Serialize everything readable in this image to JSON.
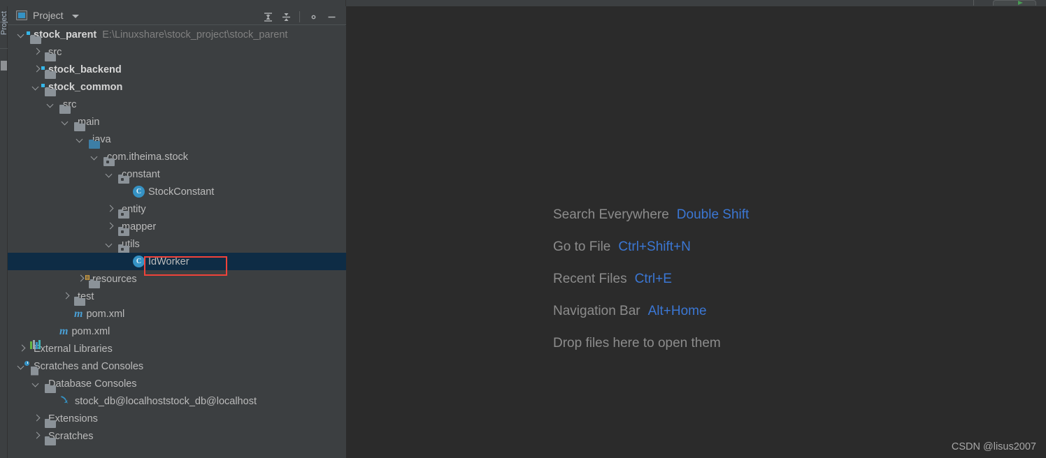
{
  "window": {
    "tool_window_title": "Project",
    "vertical_strip_label": "Project",
    "toolbar_buttons": [
      {
        "name": "expand-all",
        "tooltip": "Expand All"
      },
      {
        "name": "collapse-all",
        "tooltip": "Collapse All"
      },
      {
        "name": "settings",
        "tooltip": "Settings"
      },
      {
        "name": "hide",
        "tooltip": "Hide"
      }
    ]
  },
  "tree": {
    "rows": [
      {
        "indent": 0,
        "arrow": "down",
        "icon": "module-folder",
        "label": "stock_parent",
        "bold": true,
        "sub": "E:\\Linuxshare\\stock_project\\stock_parent",
        "selected": false
      },
      {
        "indent": 1,
        "arrow": "right",
        "icon": "folder",
        "label": "src",
        "bold": false,
        "sub": "",
        "selected": false
      },
      {
        "indent": 1,
        "arrow": "right",
        "icon": "module-folder",
        "label": "stock_backend",
        "bold": true,
        "sub": "",
        "selected": false
      },
      {
        "indent": 1,
        "arrow": "down",
        "icon": "module-folder",
        "label": "stock_common",
        "bold": true,
        "sub": "",
        "selected": false
      },
      {
        "indent": 2,
        "arrow": "down",
        "icon": "folder",
        "label": "src",
        "bold": false,
        "sub": "",
        "selected": false
      },
      {
        "indent": 3,
        "arrow": "down",
        "icon": "folder",
        "label": "main",
        "bold": false,
        "sub": "",
        "selected": false
      },
      {
        "indent": 4,
        "arrow": "down",
        "icon": "source-folder",
        "label": "java",
        "bold": false,
        "sub": "",
        "selected": false
      },
      {
        "indent": 5,
        "arrow": "down",
        "icon": "package",
        "label": "com.itheima.stock",
        "bold": false,
        "sub": "",
        "selected": false
      },
      {
        "indent": 6,
        "arrow": "down",
        "icon": "package",
        "label": "constant",
        "bold": false,
        "sub": "",
        "selected": false
      },
      {
        "indent": 7,
        "arrow": "none",
        "icon": "java-class",
        "label": "StockConstant",
        "bold": false,
        "sub": "",
        "selected": false
      },
      {
        "indent": 6,
        "arrow": "right",
        "icon": "package",
        "label": "entity",
        "bold": false,
        "sub": "",
        "selected": false
      },
      {
        "indent": 6,
        "arrow": "right",
        "icon": "package",
        "label": "mapper",
        "bold": false,
        "sub": "",
        "selected": false
      },
      {
        "indent": 6,
        "arrow": "down",
        "icon": "package",
        "label": "utils",
        "bold": false,
        "sub": "",
        "selected": false
      },
      {
        "indent": 7,
        "arrow": "none",
        "icon": "java-class",
        "label": "IdWorker",
        "bold": false,
        "sub": "",
        "selected": true
      },
      {
        "indent": 4,
        "arrow": "right",
        "icon": "resource-folder",
        "label": "resources",
        "bold": false,
        "sub": "",
        "selected": false
      },
      {
        "indent": 3,
        "arrow": "right",
        "icon": "folder",
        "label": "test",
        "bold": false,
        "sub": "",
        "selected": false
      },
      {
        "indent": 3,
        "arrow": "none",
        "icon": "maven",
        "label": "pom.xml",
        "bold": false,
        "sub": "",
        "selected": false
      },
      {
        "indent": 2,
        "arrow": "none",
        "icon": "maven",
        "label": "pom.xml",
        "bold": false,
        "sub": "",
        "selected": false
      },
      {
        "indent": 0,
        "arrow": "right",
        "icon": "libraries",
        "label": "External Libraries",
        "bold": false,
        "sub": "",
        "selected": false
      },
      {
        "indent": 0,
        "arrow": "down",
        "icon": "scratches",
        "label": "Scratches and Consoles",
        "bold": false,
        "sub": "",
        "selected": false
      },
      {
        "indent": 1,
        "arrow": "down",
        "icon": "folder",
        "label": "Database Consoles",
        "bold": false,
        "sub": "",
        "selected": false
      },
      {
        "indent": 2,
        "arrow": "none",
        "icon": "mysql",
        "label": "stock_db@localhoststock_db@localhost",
        "bold": false,
        "sub": "",
        "selected": false
      },
      {
        "indent": 1,
        "arrow": "right",
        "icon": "folder",
        "label": "Extensions",
        "bold": false,
        "sub": "",
        "selected": false
      },
      {
        "indent": 1,
        "arrow": "right",
        "icon": "folder",
        "label": "Scratches",
        "bold": false,
        "sub": "",
        "selected": false
      }
    ]
  },
  "editor": {
    "hints": [
      {
        "label": "Search Everywhere",
        "key": "Double Shift"
      },
      {
        "label": "Go to File",
        "key": "Ctrl+Shift+N"
      },
      {
        "label": "Recent Files",
        "key": "Ctrl+E"
      },
      {
        "label": "Navigation Bar",
        "key": "Alt+Home"
      },
      {
        "label": "Drop files here to open them",
        "key": ""
      }
    ],
    "watermark": "CSDN @lisus2007"
  },
  "colors": {
    "panel_bg": "#3c3f41",
    "editor_bg": "#2b2b2b",
    "selection_bg": "#0e2c45",
    "text": "#bbbbbb",
    "muted_text": "#808080",
    "accent_blue": "#3b77d4",
    "icon_blue": "#3592c4",
    "annotation_red": "#f0433a"
  }
}
